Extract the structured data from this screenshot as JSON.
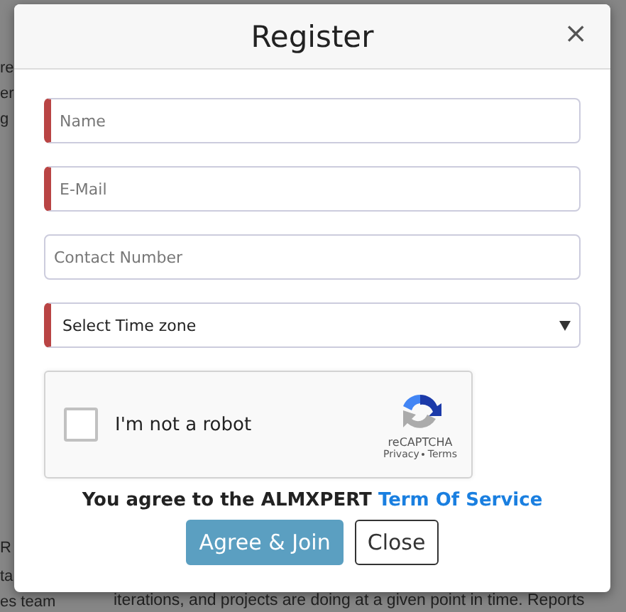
{
  "background_page": {
    "left_fragments": [
      "re",
      "er",
      "g",
      "R",
      "ta",
      "es  team"
    ],
    "bottom_text": "iterations, and projects are doing at a given point in time. Reports"
  },
  "dialog": {
    "title": "Register",
    "close_icon": "×",
    "fields": [
      {
        "kind": "input",
        "placeholder": "Name",
        "required": true
      },
      {
        "kind": "input",
        "placeholder": "E-Mail",
        "required": true
      },
      {
        "kind": "input",
        "placeholder": "Contact Number",
        "required": false
      },
      {
        "kind": "select",
        "value": "Select Time zone",
        "required": true
      }
    ],
    "captcha": {
      "label": "I'm not a robot",
      "checked": false,
      "brand": "reCAPTCHA",
      "privacy": "Privacy",
      "terms": "Terms"
    },
    "agreement": {
      "text": "You agree to the ALMXPERT",
      "link": "Term Of Service"
    },
    "buttons": [
      {
        "label": "Agree & Join",
        "kind": "primary"
      },
      {
        "label": "Close",
        "kind": "secondary"
      }
    ]
  }
}
